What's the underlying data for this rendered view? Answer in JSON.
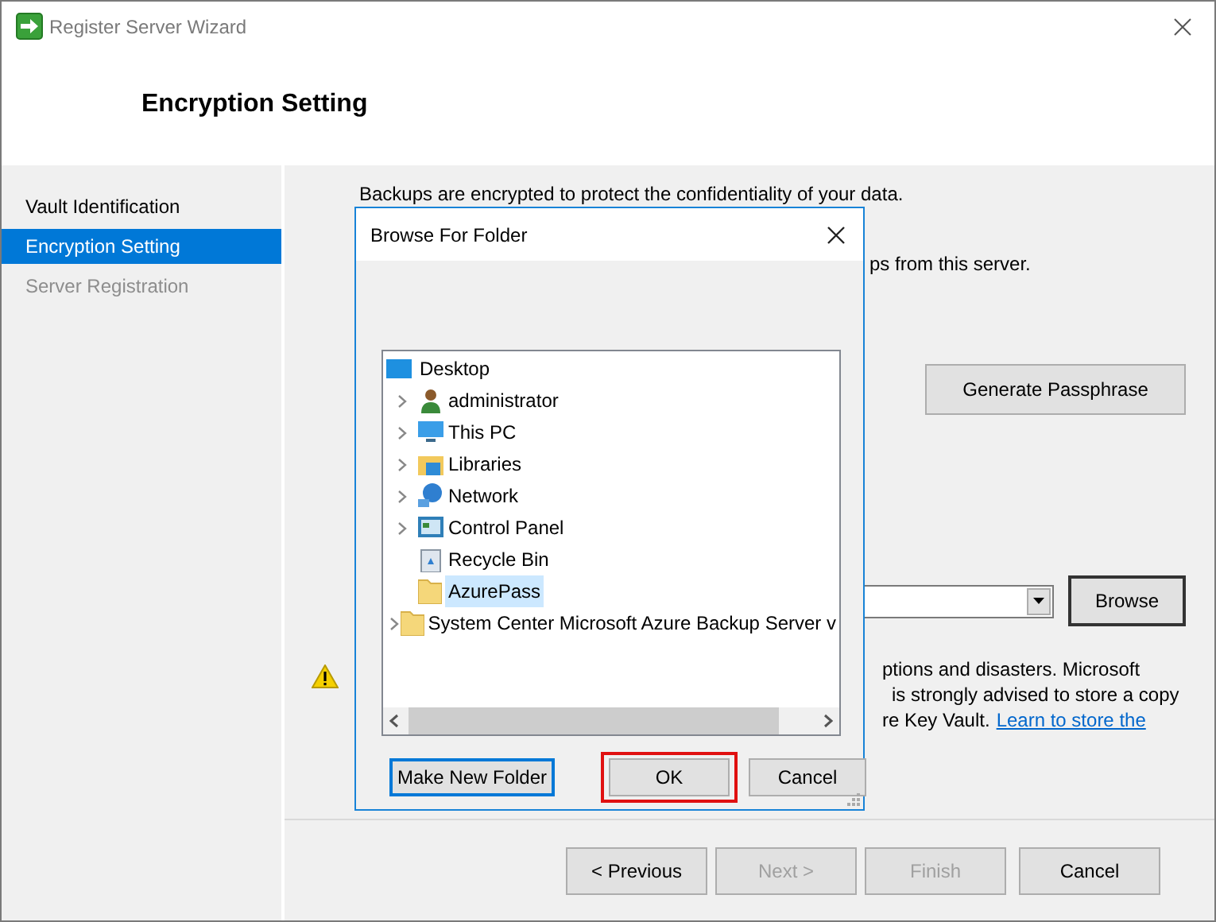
{
  "window": {
    "title": "Register Server Wizard"
  },
  "header": {
    "title": "Encryption Setting"
  },
  "steps": [
    {
      "label": "Vault Identification",
      "selected": false,
      "disabled": false
    },
    {
      "label": "Encryption Setting",
      "selected": true,
      "disabled": false
    },
    {
      "label": "Server Registration",
      "selected": false,
      "disabled": true
    }
  ],
  "content": {
    "intro": "Backups are encrypted to protect the confidentiality of your data.",
    "line_2": "ps from this server.",
    "generate_button": "Generate Passphrase",
    "browse_button": "Browse",
    "warning_lines": [
      "ptions and disasters. Microsoft",
      "is strongly advised to store a copy",
      "re Key Vault."
    ],
    "warning_link": "Learn to store the"
  },
  "dialog": {
    "title": "Browse For Folder",
    "tree": {
      "label": "Desktop",
      "kind": "desktop",
      "children": [
        {
          "label": "administrator",
          "kind": "user",
          "has_children": true,
          "selected": false
        },
        {
          "label": "This PC",
          "kind": "pc",
          "has_children": true,
          "selected": false
        },
        {
          "label": "Libraries",
          "kind": "libraries",
          "has_children": true,
          "selected": false
        },
        {
          "label": "Network",
          "kind": "network",
          "has_children": true,
          "selected": false
        },
        {
          "label": "Control Panel",
          "kind": "control",
          "has_children": true,
          "selected": false
        },
        {
          "label": "Recycle Bin",
          "kind": "recycle",
          "has_children": false,
          "selected": false
        },
        {
          "label": "AzurePass",
          "kind": "folder",
          "has_children": false,
          "selected": true
        },
        {
          "label": "System Center Microsoft Azure Backup Server v",
          "kind": "folder",
          "has_children": true,
          "selected": false
        }
      ]
    },
    "buttons": [
      {
        "label": "Make New Folder",
        "focused": true,
        "highlighted": false
      },
      {
        "label": "OK",
        "focused": false,
        "highlighted": true
      },
      {
        "label": "Cancel",
        "focused": false,
        "highlighted": false
      }
    ]
  },
  "footer": {
    "buttons": [
      {
        "label": "< Previous",
        "disabled": false
      },
      {
        "label": "Next >",
        "disabled": true
      },
      {
        "label": "Finish",
        "disabled": true
      },
      {
        "label": "Cancel",
        "disabled": false
      }
    ]
  }
}
